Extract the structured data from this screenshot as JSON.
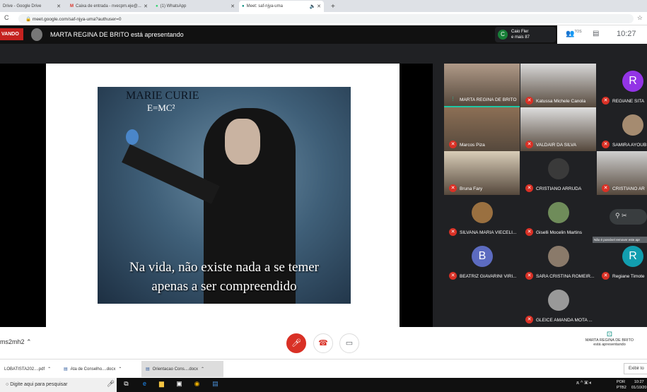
{
  "browser": {
    "tabs": [
      {
        "label": "Drive - Google Drive"
      },
      {
        "label": "Caixa de entrada - nvecpm.eje@..."
      },
      {
        "label": "(1) WhatsApp"
      },
      {
        "label": "Meet: saf-njya-uma",
        "active": true
      }
    ],
    "url": "meet.google.com/saf-njya-uma?authuser=0"
  },
  "meet": {
    "recording_badge": "VANDO",
    "presenting_text": "MARTA REGINA DE BRITO está apresentando",
    "caio": {
      "initial": "C",
      "line1": "Caio Fler",
      "line2": "e mais 87"
    },
    "people_label": "TOS",
    "time": "10:27",
    "meeting_code": "ms2mh2",
    "slide": {
      "title": "MARIE CURIE",
      "formula": "E=MC²",
      "quote_line1": "Na vida, não existe nada a se temer",
      "quote_line2": "apenas a ser compreendido"
    },
    "participants": [
      {
        "name": "MARTA REGINA DE BRITO",
        "speaking": true
      },
      {
        "name": "Katussa Michele Canola"
      },
      {
        "name": "REGIANE SITA",
        "initial": "R",
        "color": "#9334e6"
      },
      {
        "name": "Marcos Piza"
      },
      {
        "name": "VALDAIR DA SILVA"
      },
      {
        "name": "SAMIRA AYOUB"
      },
      {
        "name": "Bruna Fary"
      },
      {
        "name": "CRISTIANO ARRUDA"
      },
      {
        "name": "CRISTIANO AR"
      },
      {
        "name": "SILVANA MARIA VIECELI..."
      },
      {
        "name": "Giselli Mocelin Martins"
      },
      {
        "name": ""
      },
      {
        "name": "BEATRIZ GIAVARINI VIRI...",
        "initial": "B",
        "color": "#5c6bc0"
      },
      {
        "name": "SARA CRISTINA ROMEIR..."
      },
      {
        "name": "Regiane Timote",
        "initial": "R",
        "color": "#129eaf"
      },
      {
        "name": "GLEICE AMANDA MOTA ..."
      }
    ],
    "tooltip": "Não é possível remover este apr",
    "presenting_footer_line1": "MARTA REGINA DE BRITO",
    "presenting_footer_line2": "está apresentando"
  },
  "downloads": [
    {
      "label": "LOBATISTA202....pdf"
    },
    {
      "label": "Ata de Conselho....docx"
    },
    {
      "label": "Orientacao Cons....docx"
    }
  ],
  "downloads_show_all": "Exibir to",
  "taskbar": {
    "search_placeholder": "Digite aqui para pesquisar",
    "lang1": "POR",
    "lang2": "PTB2",
    "time": "10:27",
    "date": "01/10/20"
  }
}
